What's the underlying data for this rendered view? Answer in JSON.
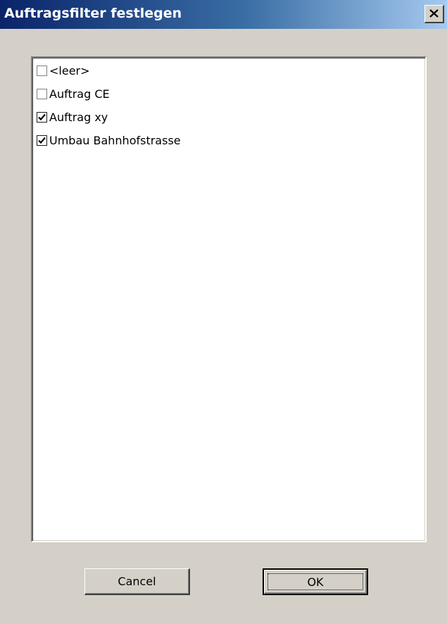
{
  "window": {
    "title": "Auftragsfilter festlegen",
    "close_icon": "close-icon"
  },
  "list": {
    "items": [
      {
        "label": "<leer>",
        "checked": false
      },
      {
        "label": "Auftrag CE",
        "checked": false
      },
      {
        "label": "Auftrag xy",
        "checked": true
      },
      {
        "label": "Umbau Bahnhofstrasse",
        "checked": true
      }
    ]
  },
  "buttons": {
    "cancel_label": "Cancel",
    "ok_label": "OK"
  },
  "colors": {
    "titlebar_start": "#0a246a",
    "titlebar_end": "#a6caf0",
    "dialog_bg": "#d4d0c8"
  }
}
